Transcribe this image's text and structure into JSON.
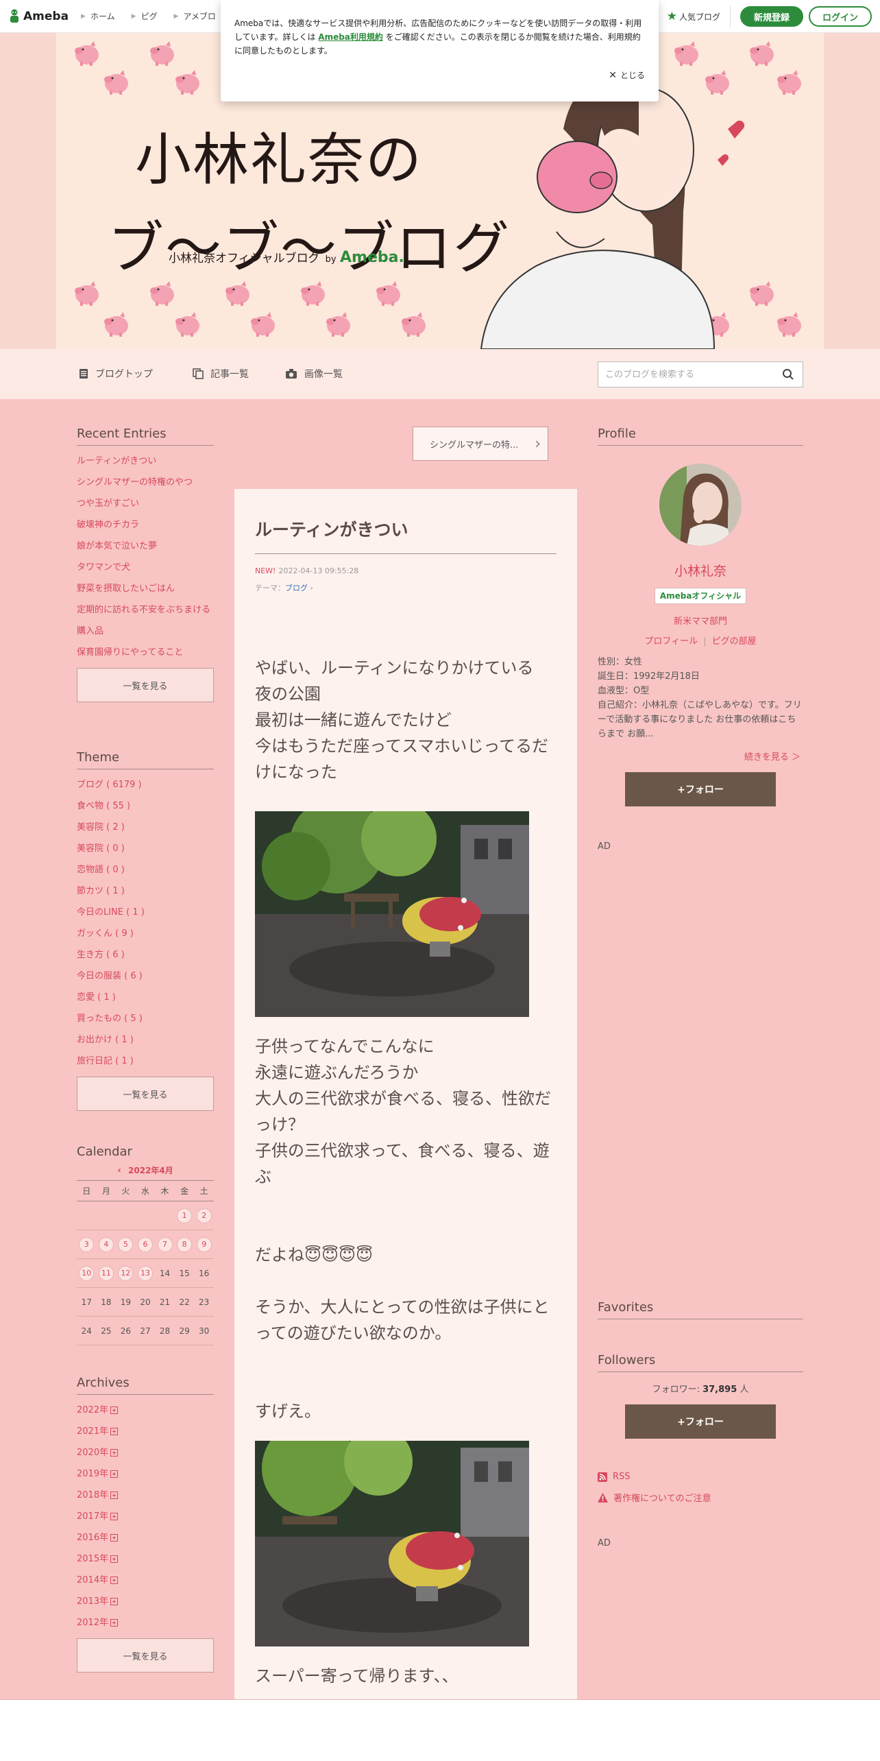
{
  "topbar": {
    "logo_text": "Ameba",
    "nav": [
      "ホーム",
      "ピグ",
      "アメブロ"
    ],
    "popular": "人気ブログ",
    "signup": "新規登録",
    "login": "ログイン"
  },
  "cookie": {
    "text_before": "Amebaでは、快適なサービス提供や利用分析、広告配信のためにクッキーなどを使い訪問データの取得・利用しています。詳しくは",
    "link": "Ameba利用規約",
    "text_after": "をご確認ください。この表示を閉じるか閲覧を続けた場合、利用規約に同意したものとします。",
    "close": "とじる"
  },
  "header": {
    "title_line1": "小林礼奈の",
    "title_line2": "ブ〜ブ〜ブログ",
    "subtitle": "小林礼奈オフィシャルブログ",
    "by": "by",
    "brand": "Ameba."
  },
  "subnav": {
    "blog_top": "ブログトップ",
    "entries": "記事一覧",
    "images": "画像一覧",
    "search_placeholder": "このブログを検索する"
  },
  "recent": {
    "title": "Recent Entries",
    "items": [
      "ルーティンがきつい",
      "シングルマザーの特権のやつ",
      "つや玉がすごい",
      "破壊神のチカラ",
      "娘が本気で泣いた夢",
      "タワマンで犬",
      "野菜を摂取したいごはん",
      "定期的に訪れる不安をぶちまける",
      "購入品",
      "保育園帰りにやってること"
    ],
    "more": "一覧を見る"
  },
  "theme": {
    "title": "Theme",
    "items": [
      "ブログ ( 6179 )",
      "食べ物 ( 55 )",
      "美容院 ( 2 )",
      "美容院 ( 0 )",
      "恋物語 ( 0 )",
      "節カツ ( 1 )",
      "今日のLINE ( 1 )",
      "ガッくん ( 9 )",
      "生き方 ( 6 )",
      "今日の服装 ( 6 )",
      "恋愛 ( 1 )",
      "買ったもの ( 5 )",
      "お出かけ ( 1 )",
      "旅行日記 ( 1 )"
    ],
    "more": "一覧を見る"
  },
  "calendar": {
    "title": "Calendar",
    "month": "2022年4月",
    "weekdays": [
      "日",
      "月",
      "火",
      "水",
      "木",
      "金",
      "土"
    ],
    "weeks": [
      [
        "",
        "",
        "",
        "",
        "",
        "1",
        "2"
      ],
      [
        "3",
        "4",
        "5",
        "6",
        "7",
        "8",
        "9"
      ],
      [
        "10",
        "11",
        "12",
        "13",
        "14",
        "15",
        "16"
      ],
      [
        "17",
        "18",
        "19",
        "20",
        "21",
        "22",
        "23"
      ],
      [
        "24",
        "25",
        "26",
        "27",
        "28",
        "29",
        "30"
      ]
    ],
    "post_days": [
      "1",
      "2",
      "3",
      "4",
      "5",
      "6",
      "7",
      "8",
      "9",
      "10",
      "11",
      "12",
      "13"
    ]
  },
  "archives": {
    "title": "Archives",
    "years": [
      "2022年",
      "2021年",
      "2020年",
      "2019年",
      "2018年",
      "2017年",
      "2016年",
      "2015年",
      "2014年",
      "2013年",
      "2012年"
    ],
    "more": "一覧を見る"
  },
  "next_entry": "シングルマザーの特...",
  "article": {
    "title": "ルーティンがきつい",
    "new": "NEW!",
    "date": "2022-04-13 09:55:28",
    "theme_label": "テーマ：",
    "theme": "ブログ",
    "p1": [
      "やばい、ルーティンになりかけている",
      "夜の公園",
      "最初は一緒に遊んでたけど",
      "今はもうただ座ってスマホいじってるだけになった"
    ],
    "p2": [
      "子供ってなんでこんなに",
      "永遠に遊ぶんだろうか",
      "大人の三代欲求が食べる、寝る、性欲だっけ？",
      "子供の三代欲求って、食べる、寝る、遊ぶ"
    ],
    "p3": "だよね😇😇😇😇",
    "p4": [
      "そうか、大人にとっての性欲は子供にとっての遊びたい欲なのか。"
    ],
    "p5": "すげえ。",
    "p6": "スーパー寄って帰ります、、"
  },
  "profile": {
    "title": "Profile",
    "name": "小林礼奈",
    "badge": "Amebaオフィシャル",
    "dept": "新米ママ部門",
    "link_profile": "プロフィール",
    "link_pig": "ピグの部屋",
    "info": [
      "性別：女性",
      "誕生日：1992年2月18日",
      "血液型：O型",
      "自己紹介：小林礼奈（こばやしあやな）です。フリーで活動する事になりました お仕事の依頼はこちらまで お願..."
    ],
    "more": "続きを見る ＞",
    "follow": "+フォロー"
  },
  "ad_label": "AD",
  "favorites": {
    "title": "Favorites"
  },
  "followers": {
    "title": "Followers",
    "label": "フォロワー:",
    "count": "37,895",
    "unit": "人",
    "follow": "+フォロー"
  },
  "links": {
    "rss": "RSS",
    "copyright": "著作権についてのご注意"
  },
  "colors": {
    "accent": "#d8485c",
    "green": "#2d8c3c",
    "bg": "#f8c5c4",
    "follow": "#6b5749"
  }
}
